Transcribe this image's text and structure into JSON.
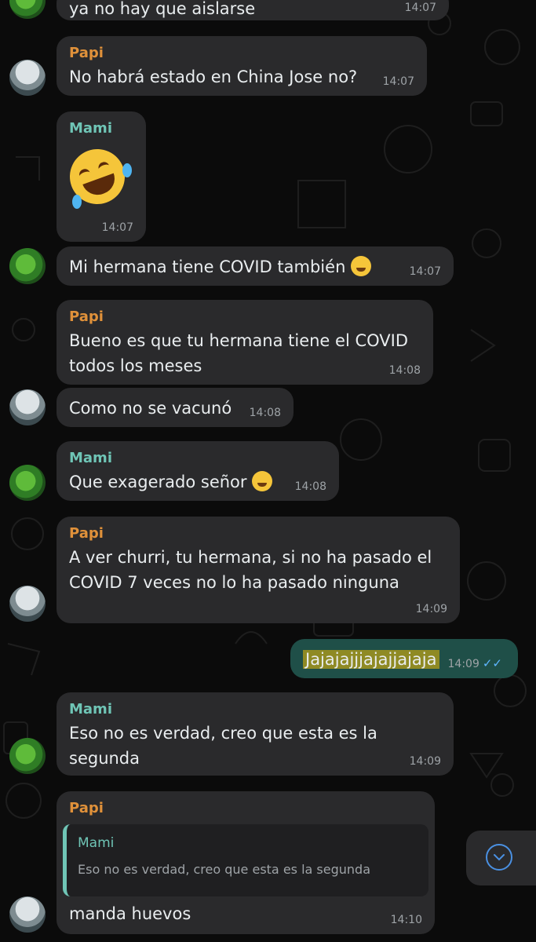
{
  "messages": [
    {
      "text": "ya no hay que aislarse",
      "time": "14:07"
    },
    {
      "sender": "Papi",
      "text": "No habrá estado en China Jose no?",
      "time": "14:07"
    },
    {
      "sender": "Mami",
      "time": "14:07",
      "sticker": "rolling-laughing-emoji"
    },
    {
      "text": "Mi hermana tiene COVID también",
      "emoji": "weary-face",
      "time": "14:07"
    },
    {
      "sender": "Papi",
      "line1": "Bueno es que tu hermana tiene el COVID",
      "line2": "todos los meses",
      "time": "14:08"
    },
    {
      "text": "Como no se vacunó",
      "time": "14:08"
    },
    {
      "sender": "Mami",
      "text": "Que exagerado señor",
      "emoji": "sweat-smile",
      "time": "14:08"
    },
    {
      "sender": "Papi",
      "line1": "A ver churri, tu hermana, si no ha pasado el",
      "line2": "COVID 7 veces no lo ha pasado ninguna",
      "time": "14:09"
    },
    {
      "text": "Jajajajjjajajjajaja",
      "time": "14:09",
      "status": "✓✓"
    },
    {
      "sender": "Mami",
      "line1": "Eso no es verdad, creo que esta es la",
      "line2": "segunda",
      "time": "14:09"
    },
    {
      "sender": "Papi",
      "quote_sender": "Mami",
      "quote_text": "Eso no es verdad, creo que esta es la segunda",
      "text": "manda huevos",
      "time": "14:10"
    }
  ],
  "colors": {
    "background": "#0b0b0b",
    "incoming": "#2a2a2c",
    "outgoing": "#1f4f48",
    "papi_name": "#e0913a",
    "mami_name": "#6fc5b6",
    "read_ticks": "#5fb6ff"
  },
  "scroll_button": {
    "icon": "chevron-down-icon"
  }
}
